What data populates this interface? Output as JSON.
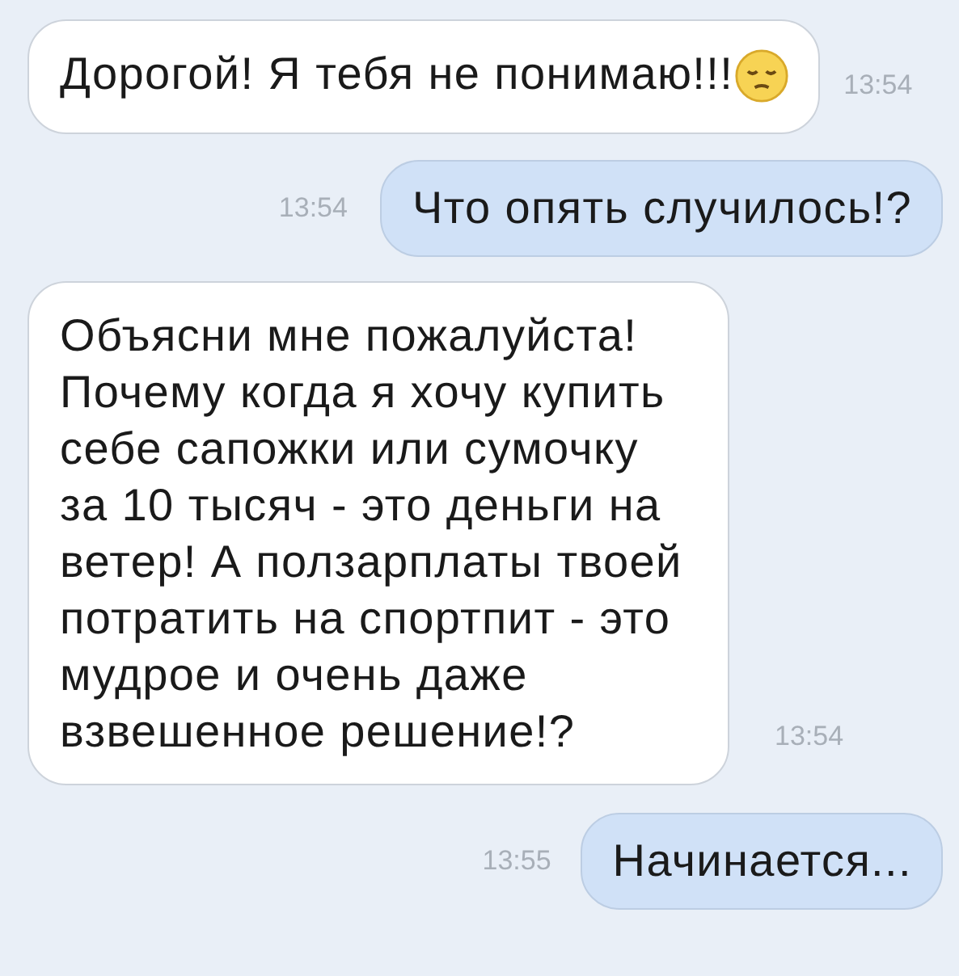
{
  "messages": [
    {
      "kind": "incoming",
      "text": "Дорогой! Я тебя не понимаю!!!",
      "emoji": true,
      "time": "13:54"
    },
    {
      "kind": "outgoing",
      "text": "Что опять случилось!?",
      "emoji": false,
      "time": "13:54"
    },
    {
      "kind": "incoming",
      "text": "Объясни мне пожалуйста! Почему когда я хочу купить себе сапожки или сумочку за 10 тысяч - это деньги на ветер! А ползарплаты твоей потратить на спортпит - это мудрое и очень даже взвешенное решение!?",
      "emoji": false,
      "time": "13:54"
    },
    {
      "kind": "outgoing",
      "text": "Начинается...",
      "emoji": false,
      "time": "13:55"
    }
  ]
}
